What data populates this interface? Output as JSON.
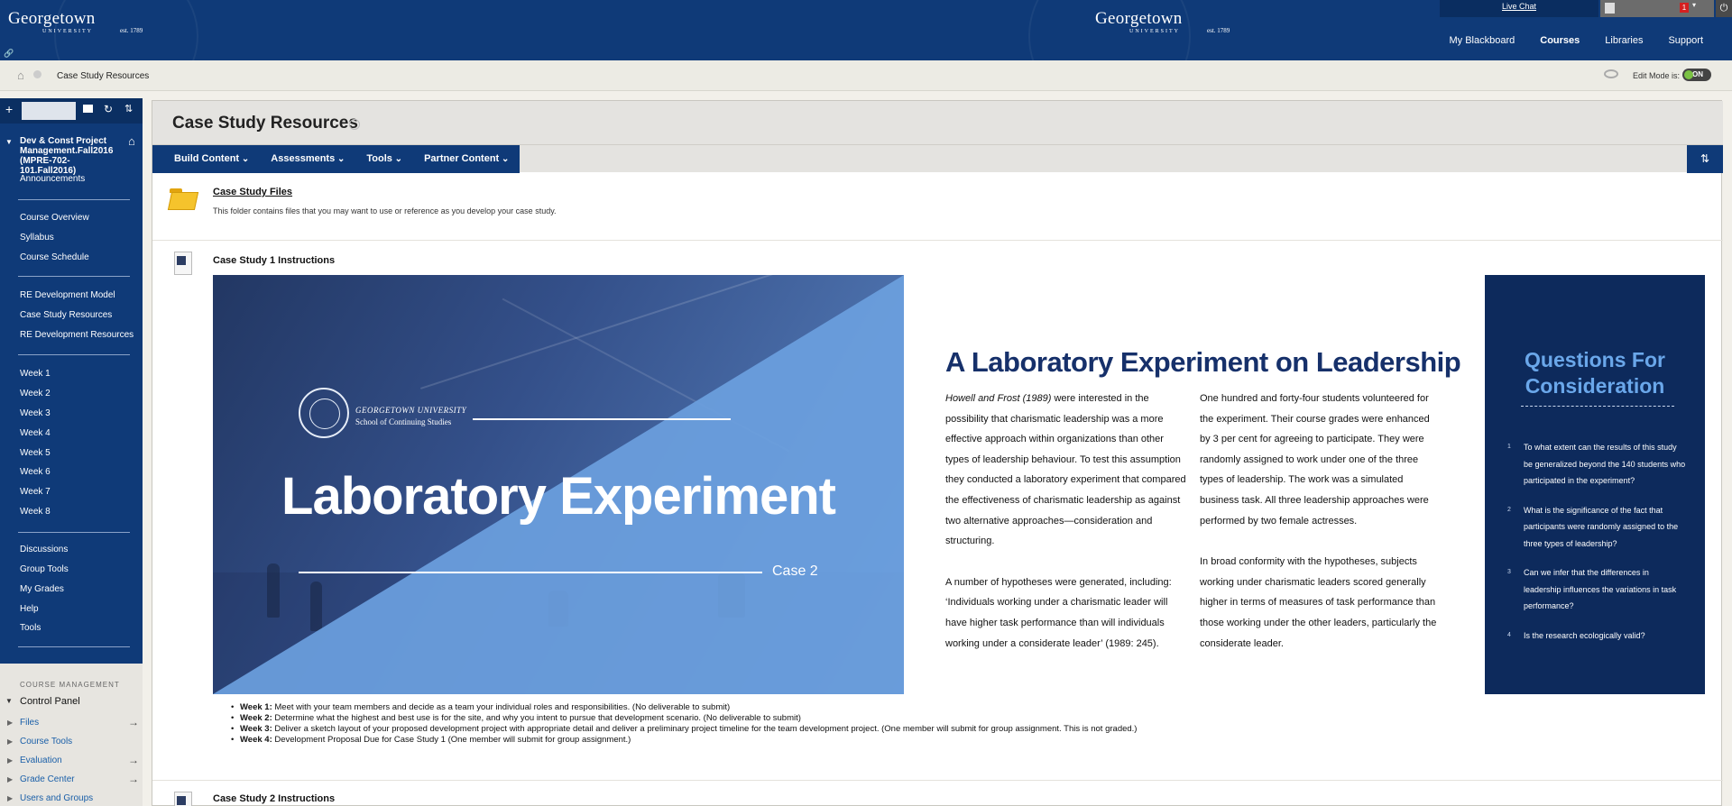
{
  "header": {
    "logo_name": "Georgetown",
    "logo_sub": "UNIVERSITY",
    "logo_est": "est. 1789",
    "live_chat": "Live Chat",
    "notification_count": "1",
    "nav_tabs": [
      {
        "label": "My Blackboard",
        "active": false
      },
      {
        "label": "Courses",
        "active": true
      },
      {
        "label": "Libraries",
        "active": false
      },
      {
        "label": "Support",
        "active": false
      }
    ]
  },
  "breadcrumb": {
    "current": "Case Study Resources",
    "edit_mode_label": "Edit Mode is:",
    "edit_mode_value": "ON"
  },
  "sidebar": {
    "course_title": "Dev & Const Project Management.Fall2016 (MPRE-702-101.Fall2016)",
    "groups": [
      [
        "Announcements"
      ],
      [
        "Course Overview",
        "Syllabus",
        "Course Schedule"
      ],
      [
        "RE Development Model",
        "Case Study Resources",
        "RE Development Resources"
      ],
      [
        "Week 1",
        "Week 2",
        "Week 3",
        "Week 4",
        "Week 5",
        "Week 6",
        "Week 7",
        "Week 8"
      ],
      [
        "Discussions",
        "Group Tools",
        "My Grades",
        "Help",
        "Tools"
      ]
    ],
    "course_management": {
      "title": "COURSE MANAGEMENT",
      "control_panel": "Control Panel",
      "items": [
        "Files",
        "Course Tools",
        "Evaluation",
        "Grade Center",
        "Users and Groups"
      ]
    }
  },
  "main": {
    "page_title": "Case Study Resources",
    "action_menu": [
      "Build Content",
      "Assessments",
      "Tools",
      "Partner Content"
    ],
    "items": [
      {
        "title": "Case Study Files",
        "description": "This folder contains files that you may want to use or reference as you develop your case study."
      },
      {
        "title": "Case Study 1 Instructions"
      },
      {
        "title": "Case Study 2 Instructions"
      }
    ],
    "infographic": {
      "university": "GEORGETOWN UNIVERSITY",
      "school": "School of Continuing Studies",
      "hero_title": "Laboratory Experiment",
      "case_label": "Case 2",
      "article_title": "A Laboratory Experiment on Leadership",
      "col1_p1_cite": "Howell and Frost (1989)",
      "col1_p1": " were interested in the possibility that charismatic leadership was a more effective approach within organizations than other types of leadership behaviour. To test this assumption they conducted a laboratory experiment that compared the effectiveness of charismatic leadership as against two alternative approaches—consideration and structuring.",
      "col1_p2": "A number of hypotheses were generated, including: ‘Individuals working under a charismatic leader will have higher task performance than will individuals working under a considerate leader’ (1989: 245).",
      "col2_p1": "One hundred and forty-four students volunteered for the experiment. Their course grades were enhanced by 3 per cent for agreeing to participate. They were randomly assigned to work under one of the three types of leadership. The work was a simulated business task. All three leadership approaches were performed by two female actresses.",
      "col2_p2": "In broad conformity with the hypotheses, subjects working under charismatic leaders scored generally higher in terms of measures of task performance than those working under the other leaders, particularly the considerate leader.",
      "questions_title": "Questions For Consideration",
      "questions": [
        "To what extent can the results of this study be generalized beyond the 140 students who participated in the experiment?",
        "What is the significance of the fact that participants were randomly assigned to the three types of leadership?",
        "Can we infer that the differences in leadership influences the variations in task performance?",
        "Is the research ecologically valid?"
      ]
    },
    "weeks": [
      {
        "label": "Week 1:",
        "text": " Meet with your team members and decide as a team your individual roles and responsibilities. (No deliverable to submit)"
      },
      {
        "label": "Week 2:",
        "text": " Determine what the highest and best use is for the site, and why you intent to pursue that development scenario. (No deliverable to submit)"
      },
      {
        "label": "Week 3:",
        "text": " Deliver a sketch layout of your proposed development project with appropriate detail and deliver a preliminary project timeline for the team development project. (One member will submit for group assignment. This is not graded.)"
      },
      {
        "label": "Week 4:",
        "text": " Development Proposal Due for Case Study 1 (One member will submit for group assignment.)"
      }
    ]
  },
  "colors": {
    "header_blue": "#0f3a78",
    "accent_light_blue": "#6b9fde",
    "navy": "#0d2a5c",
    "toggle_green": "#7bc243"
  },
  "icons": [
    "home-icon",
    "link-icon",
    "power-icon",
    "eye-icon",
    "folder-icon",
    "document-icon",
    "refresh-icon",
    "sort-icon",
    "plus-icon"
  ]
}
